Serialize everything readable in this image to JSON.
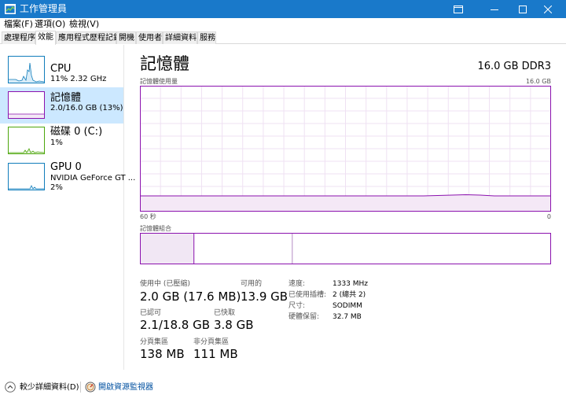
{
  "window": {
    "title": "工作管理員"
  },
  "menu": [
    "檔案(F)",
    "選項(O)",
    "檢視(V)"
  ],
  "tabs": [
    "處理程序",
    "效能",
    "應用程式歷程記錄",
    "開機",
    "使用者",
    "詳細資料",
    "服務"
  ],
  "active_tab": "效能",
  "sidebar": [
    {
      "title": "CPU",
      "subtitle": "11%  2.32 GHz",
      "color": "#117dbb"
    },
    {
      "title": "記憶體",
      "subtitle": "2.0/16.0 GB (13%)",
      "color": "#8b12ae",
      "selected": true
    },
    {
      "title": "磁碟 0 (C:)",
      "subtitle": "1%",
      "color": "#4da60c"
    },
    {
      "title": "GPU 0",
      "subtitle": "NVIDIA GeForce GT ...",
      "subtitle2": "2%",
      "color": "#117dbb"
    }
  ],
  "main": {
    "title": "記憶體",
    "spec": "16.0 GB DDR3",
    "usage_label": "記憶體使用量",
    "usage_max": "16.0 GB",
    "time_left": "60 秒",
    "time_right": "0",
    "composition_label": "記憶體組合",
    "accent_color": "#8b12ae"
  },
  "chart_data": {
    "type": "area",
    "title": "記憶體使用量",
    "xlabel": "",
    "ylabel": "",
    "x_range": [
      60,
      0
    ],
    "ylim": [
      0,
      16.0
    ],
    "series": [
      {
        "values": [
          2.0,
          2.0,
          2.0,
          2.0,
          2.0,
          2.0,
          2.0,
          2.0,
          2.0,
          2.0,
          2.0,
          2.0,
          2.0,
          2.0,
          2.0,
          2.0,
          2.0,
          2.0,
          2.0,
          2.0,
          2.0,
          2.05,
          2.1,
          2.15,
          2.1,
          2.0,
          2.0,
          2.0,
          2.0,
          2.0
        ]
      }
    ],
    "grid": true
  },
  "composition": {
    "in_use_fraction": 0.13,
    "modified_fraction": 0.0,
    "standby_fraction": 0.24
  },
  "stats": {
    "in_use_label": "使用中 (已壓縮)",
    "in_use_value": "2.0 GB (17.6 MB)",
    "available_label": "可用的",
    "available_value": "13.9 GB",
    "committed_label": "已認可",
    "committed_value": "2.1/18.8 GB",
    "cached_label": "已快取",
    "cached_value": "3.8 GB",
    "paged_label": "分頁集區",
    "paged_value": "138 MB",
    "nonpaged_label": "非分頁集區",
    "nonpaged_value": "111 MB"
  },
  "specs": [
    {
      "label": "速度:",
      "value": "1333 MHz"
    },
    {
      "label": "已使用插槽:",
      "value": "2 (總共 2)"
    },
    {
      "label": "尺寸:",
      "value": "SODIMM"
    },
    {
      "label": "硬體保留:",
      "value": "32.7 MB"
    }
  ],
  "footer": {
    "fewer_details": "較少詳細資料(D)",
    "open_monitor": "開啟資源監視器"
  }
}
